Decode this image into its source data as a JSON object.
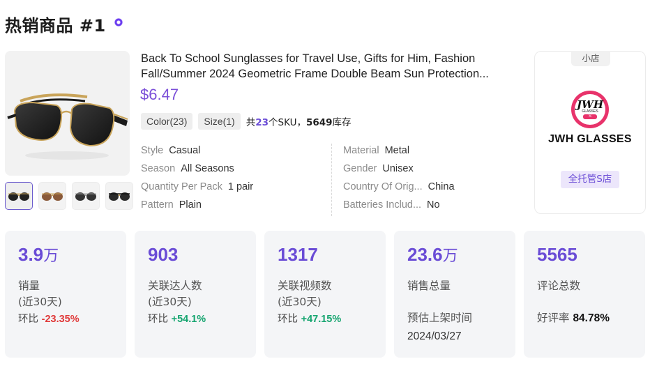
{
  "header": {
    "title": "热销商品 #1"
  },
  "product": {
    "title_line1": "Back To School Sunglasses for Travel Use, Gifts for Him, Fashion",
    "title_line2": "Fall/Summer 2024 Geometric Frame Double Beam Sun Protection...",
    "price": "$6.47",
    "tags": [
      "Color(23)",
      "Size(1)"
    ],
    "sku": {
      "prefix": "共",
      "count": "23",
      "mid": "个SKU，",
      "stock": "5649",
      "suffix": "库存"
    },
    "attributes_left": [
      {
        "key": "Style",
        "value": "Casual"
      },
      {
        "key": "Season",
        "value": "All Seasons"
      },
      {
        "key": "Quantity Per Pack",
        "value": "1 pair"
      },
      {
        "key": "Pattern",
        "value": "Plain"
      }
    ],
    "attributes_right": [
      {
        "key": "Material",
        "value": "Metal"
      },
      {
        "key": "Gender",
        "value": "Unisex"
      },
      {
        "key": "Country Of Orig...",
        "value": "China"
      },
      {
        "key": "Batteries Includ...",
        "value": "No"
      }
    ]
  },
  "shop": {
    "type": "小店",
    "logo_text": "JWH",
    "logo_sub": "GLASSES",
    "logo_badge": "S",
    "name": "JWH GLASSES",
    "badge": "全托管S店"
  },
  "stats": [
    {
      "value": "3.9",
      "unit": "万",
      "label": "销量",
      "sub": "(近30天)",
      "ratio_label": "环比 ",
      "ratio": "-23.35%"
    },
    {
      "value": "903",
      "unit": "",
      "label": "关联达人数",
      "sub": "(近30天)",
      "ratio_label": "环比 ",
      "ratio": "+54.1%"
    },
    {
      "value": "1317",
      "unit": "",
      "label": "关联视频数",
      "sub": "(近30天)",
      "ratio_label": "环比 ",
      "ratio": "+47.15%"
    },
    {
      "value": "23.6",
      "unit": "万",
      "label": "销售总量",
      "date_label": "预估上架时间",
      "date": "2024/03/27"
    },
    {
      "value": "5565",
      "unit": "",
      "label": "评论总数",
      "rating_label": "好评率 ",
      "rating": "84.78%"
    }
  ],
  "colors": {
    "accent": "#6a4cd6",
    "negative": "#e03a3a",
    "positive": "#16a570"
  }
}
